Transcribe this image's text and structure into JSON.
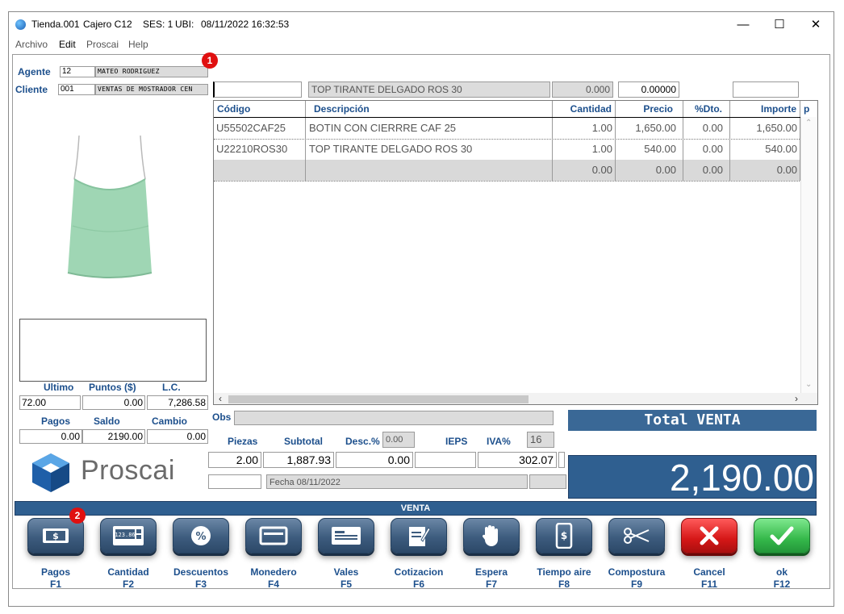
{
  "window": {
    "app_title": "Tienda.001",
    "cajero": "Cajero C12",
    "ses": "SES: 1",
    "ubi": "UBI:",
    "datetime": "08/11/2022 16:32:53",
    "minimize": "—",
    "maximize": "☐",
    "close": "✕"
  },
  "menu": [
    "Archivo",
    "Edit",
    "Proscai",
    "Help"
  ],
  "customer": {
    "agent_label": "Agente",
    "agent_code": "12",
    "agent_name": "MATEO RODRIGUEZ",
    "client_label": "Cliente",
    "client_code": "001",
    "client_name": "VENTAS DE MOSTRADOR CEN"
  },
  "badges": {
    "one": "1",
    "two": "2"
  },
  "entry": {
    "code": "",
    "description": "TOP TIRANTE DELGADO ROS 30",
    "qty": "0.000",
    "price": "0.00000",
    "extra": ""
  },
  "table": {
    "headers": [
      "Código",
      "Descripción",
      "Cantidad",
      "Precio",
      "%Dto.",
      "Importe",
      "p"
    ],
    "rows": [
      [
        "U55502CAF25",
        "BOTIN  CON CIERRRE CAF 25",
        "1.00",
        "1,650.00",
        "0.00",
        "1,650.00"
      ],
      [
        "U22210ROS30",
        "TOP TIRANTE DELGADO ROS 30",
        "1.00",
        "540.00",
        "0.00",
        "540.00"
      ],
      [
        "",
        "",
        "0.00",
        "0.00",
        "0.00",
        "0.00"
      ]
    ]
  },
  "left_stats": {
    "ultimo_label": "Ultimo",
    "puntos_label": "Puntos ($)",
    "lc_label": "L.C.",
    "ultimo": "72.00",
    "puntos": "0.00",
    "lc": "7,286.58",
    "pagos_label": "Pagos",
    "saldo_label": "Saldo",
    "cambio_label": "Cambio",
    "pagos": "0.00",
    "saldo": "2190.00",
    "cambio": "0.00"
  },
  "brand": {
    "name": "Proscai"
  },
  "totals": {
    "obs_label": "Obs",
    "obs": "",
    "piezas_label": "Piezas",
    "subtotal_label": "Subtotal",
    "desc_label": "Desc.%",
    "desc_pct": "0.00",
    "ieps_label": "IEPS",
    "iva_label": "IVA%",
    "iva_pct": "16",
    "piezas": "2.00",
    "subtotal": "1,887.93",
    "descuento": "0.00",
    "ieps": "",
    "iva": "302.07",
    "fecha": "Fecha 08/11/2022",
    "total_venta_label": "Total VENTA",
    "total": "2,190.00"
  },
  "mode_bar": "VENTA",
  "function_keys": [
    {
      "label": "Pagos",
      "key": "F1",
      "icon": "cash-icon"
    },
    {
      "label": "Cantidad",
      "key": "F2",
      "icon": "calculator-icon"
    },
    {
      "label": "Descuentos",
      "key": "F3",
      "icon": "percent-icon"
    },
    {
      "label": "Monedero",
      "key": "F4",
      "icon": "wallet-card-icon"
    },
    {
      "label": "Vales",
      "key": "F5",
      "icon": "voucher-icon"
    },
    {
      "label": "Cotizacion",
      "key": "F6",
      "icon": "quote-document-icon"
    },
    {
      "label": "Espera",
      "key": "F7",
      "icon": "hand-stop-icon"
    },
    {
      "label": "Tiempo aire",
      "key": "F8",
      "icon": "mobile-phone-icon"
    },
    {
      "label": "Compostura",
      "key": "F9",
      "icon": "scissors-icon"
    },
    {
      "label": "Cancel",
      "key": "F11",
      "icon": "cancel-x-icon"
    },
    {
      "label": "ok",
      "key": "F12",
      "icon": "checkmark-icon"
    }
  ],
  "colors": {
    "accent_blue": "#1c4f8c",
    "panel_blue": "#3a6896",
    "cancel_red": "#d51717",
    "ok_green": "#35b84a"
  }
}
